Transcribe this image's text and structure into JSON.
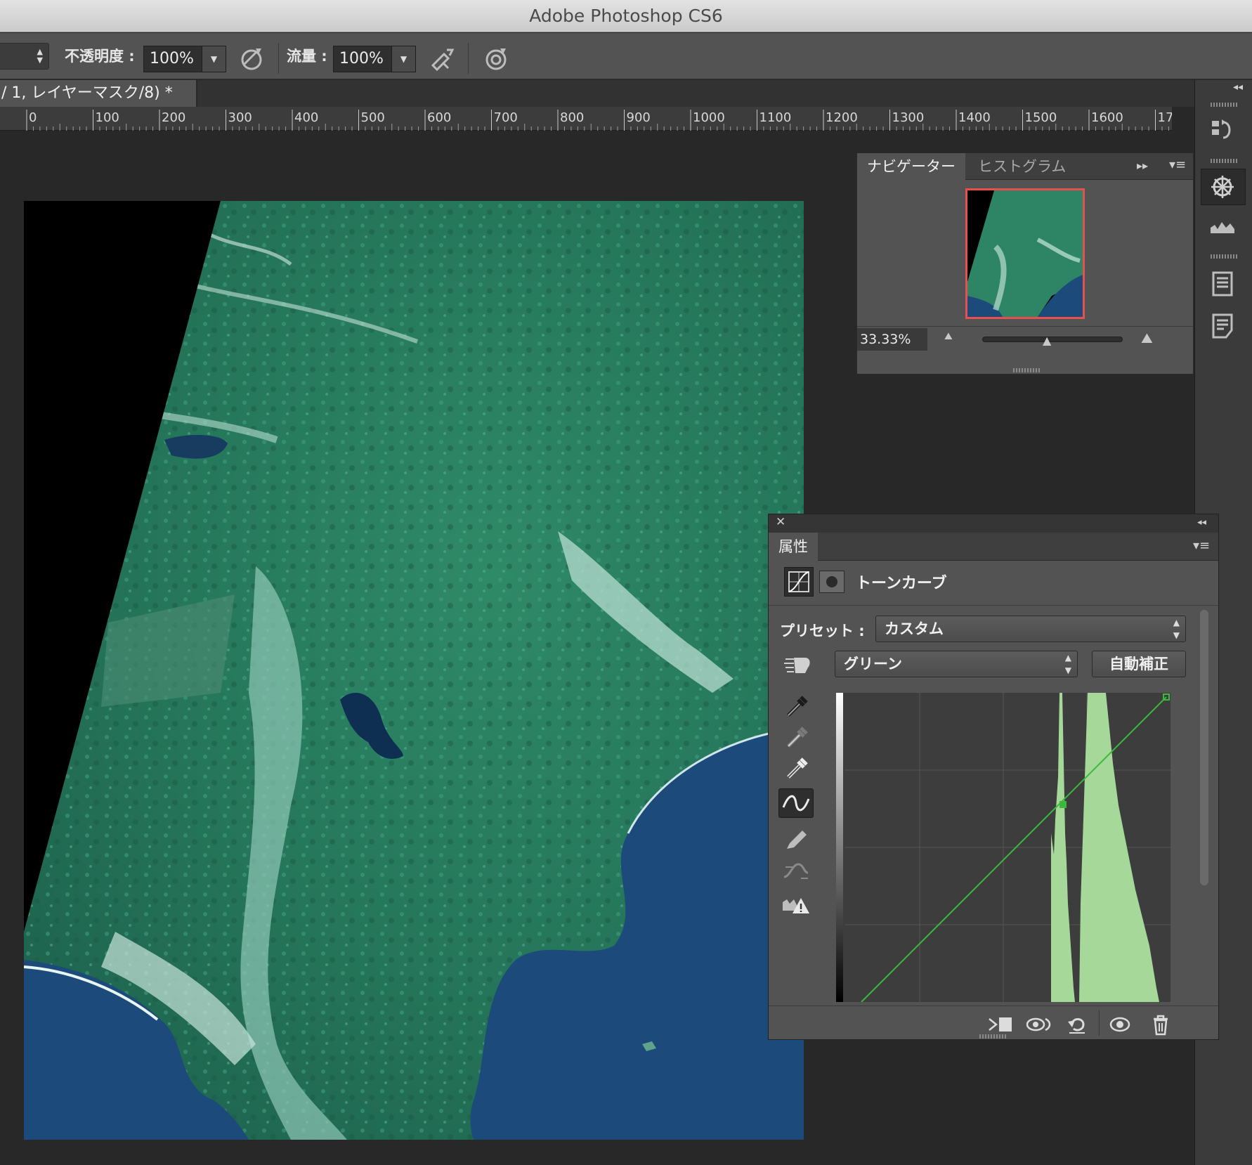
{
  "window": {
    "title": "Adobe Photoshop CS6"
  },
  "options_bar": {
    "opacity_label": "不透明度 :",
    "opacity_value": "100%",
    "flow_label": "流量 :",
    "flow_value": "100%"
  },
  "document": {
    "tab_title": "/ 1, レイヤーマスク/8) *"
  },
  "ruler": {
    "ticks": [
      "0",
      "100",
      "200",
      "300",
      "400",
      "500",
      "600",
      "700",
      "800",
      "900",
      "1000",
      "1100",
      "1200",
      "1300",
      "1400",
      "1500",
      "1600",
      "17"
    ]
  },
  "navigator": {
    "tabs": [
      {
        "label": "ナビゲーター",
        "active": true
      },
      {
        "label": "ヒストグラム",
        "active": false
      }
    ],
    "zoom": "33.33%"
  },
  "properties": {
    "tab_label": "属性",
    "adjustment_name": "トーンカーブ",
    "preset_label": "プリセット :",
    "preset_value": "カスタム",
    "channel_value": "グリーン",
    "auto_button": "自動補正"
  },
  "colors": {
    "panel_bg": "#535353",
    "canvas_bg": "#282828",
    "curve_color": "#3cb83c",
    "histogram_fill": "#a6d89a",
    "nav_frame": "#e85050"
  }
}
